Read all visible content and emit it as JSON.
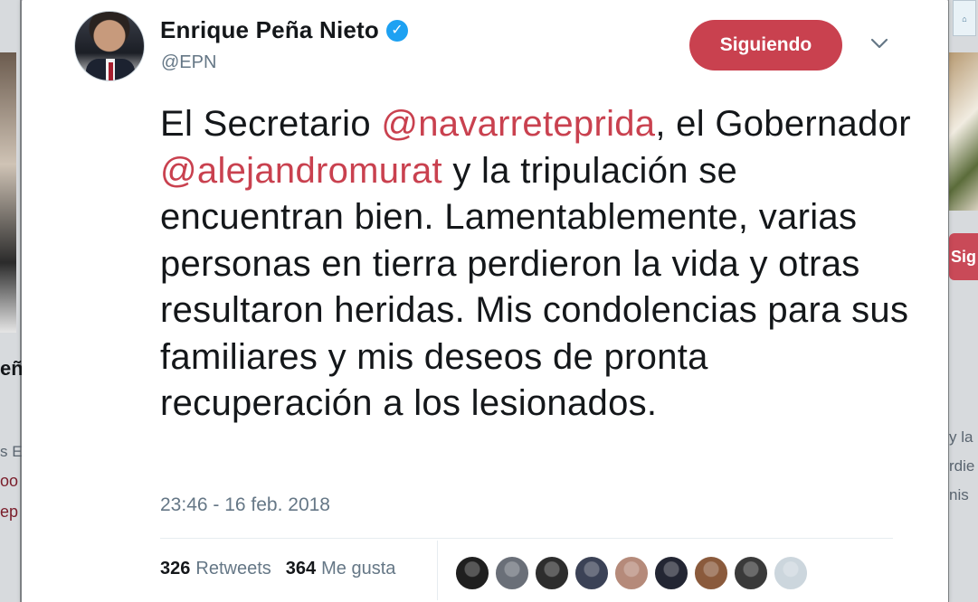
{
  "background": {
    "left_fragments": [
      "eñ",
      "s E",
      "oo",
      "ep"
    ],
    "right_fragments": [
      "y la",
      "rdie",
      "nis"
    ],
    "right_button_label": "Sig"
  },
  "tweet": {
    "display_name": "Enrique Peña Nieto",
    "handle": "@EPN",
    "verified": true,
    "follow_button_label": "Siguiendo",
    "text_segments": [
      {
        "text": "El Secretario ",
        "type": "text"
      },
      {
        "text": "@navarreteprida",
        "type": "mention"
      },
      {
        "text": ", el Gobernador ",
        "type": "text"
      },
      {
        "text": "@alejandromurat",
        "type": "mention"
      },
      {
        "text": " y la tripulación se encuentran bien. Lamentablemente, varias personas en tierra perdieron la vida y otras resultaron heridas. Mis condolencias para sus familiares y mis deseos de pronta recuperación a los lesionados.",
        "type": "text"
      }
    ],
    "timestamp": "23:46 - 16 feb. 2018",
    "retweets_count": "326",
    "retweets_label": "Retweets",
    "likes_count": "364",
    "likes_label": "Me gusta"
  },
  "liker_avatars": [
    {
      "name": "liker-avatar-1",
      "color": "#1f1f1f"
    },
    {
      "name": "liker-avatar-2",
      "color": "#6a6f78"
    },
    {
      "name": "liker-avatar-3",
      "color": "#2d2d2d"
    },
    {
      "name": "liker-avatar-4",
      "color": "#3b4256"
    },
    {
      "name": "liker-avatar-5",
      "color": "#b58a7a"
    },
    {
      "name": "liker-avatar-6",
      "color": "#232633"
    },
    {
      "name": "liker-avatar-7",
      "color": "#8a5a3c"
    },
    {
      "name": "liker-avatar-8",
      "color": "#3a3a3a"
    },
    {
      "name": "liker-avatar-9",
      "color": "#ccd6dd"
    }
  ],
  "colors": {
    "accent": "#c9414f",
    "verified": "#1da1f2",
    "muted_text": "#657786",
    "primary_text": "#14171a"
  }
}
